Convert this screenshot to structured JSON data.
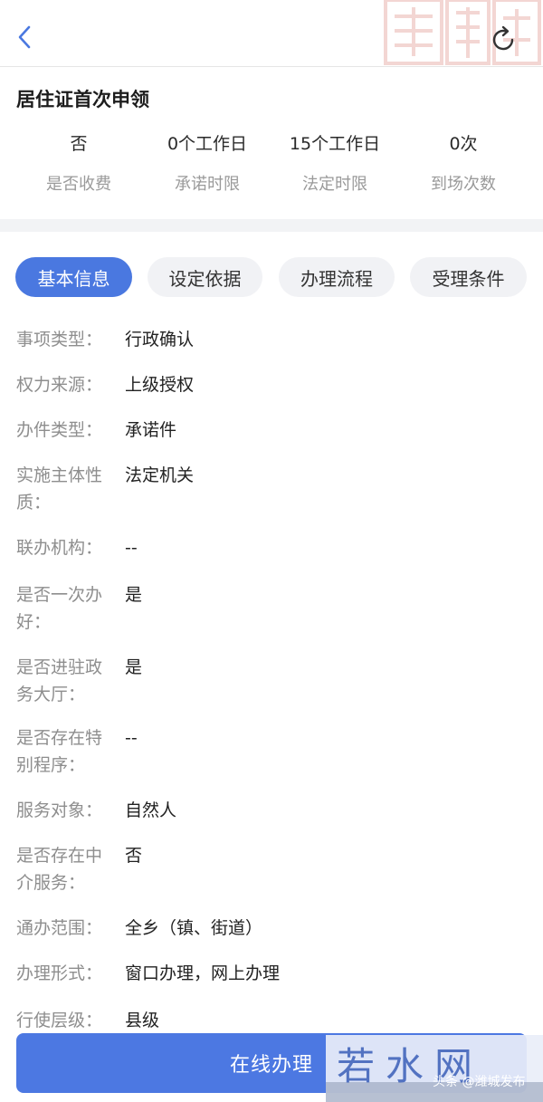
{
  "header": {
    "back_icon": "chevron-left-icon",
    "refresh_icon": "refresh-icon",
    "accent": "#4a78e0"
  },
  "summary": {
    "title": "居住证首次申领",
    "stats": [
      {
        "value": "否",
        "label": "是否收费"
      },
      {
        "value": "0个工作日",
        "label": "承诺时限"
      },
      {
        "value": "15个工作日",
        "label": "法定时限"
      },
      {
        "value": "0次",
        "label": "到场次数"
      }
    ]
  },
  "tabs": [
    {
      "label": "基本信息",
      "active": true
    },
    {
      "label": "设定依据",
      "active": false
    },
    {
      "label": "办理流程",
      "active": false
    },
    {
      "label": "受理条件",
      "active": false
    }
  ],
  "info": [
    {
      "key": "事项类型：",
      "value": "行政确认"
    },
    {
      "key": "权力来源：",
      "value": "上级授权"
    },
    {
      "key": "办件类型：",
      "value": "承诺件"
    },
    {
      "key": "实施主体性质：",
      "value": "法定机关"
    },
    {
      "key": "联办机构：",
      "value": "--"
    },
    {
      "key": "是否一次办好：",
      "value": "是"
    },
    {
      "key": "是否进驻政务大厅：",
      "value": "是"
    },
    {
      "key": "是否存在特别程序：",
      "value": "--"
    },
    {
      "key": "服务对象：",
      "value": "自然人"
    },
    {
      "key": "是否存在中介服务：",
      "value": "否"
    },
    {
      "key": "通办范围：",
      "value": "全乡（镇、街道）"
    },
    {
      "key": "办理形式：",
      "value": "窗口办理，网上办理"
    },
    {
      "key": "行使层级：",
      "value": "县级"
    }
  ],
  "footer": {
    "button_label": "在线办理"
  },
  "watermark": {
    "brand": "若水网",
    "source": "头条 @潍城发布"
  }
}
